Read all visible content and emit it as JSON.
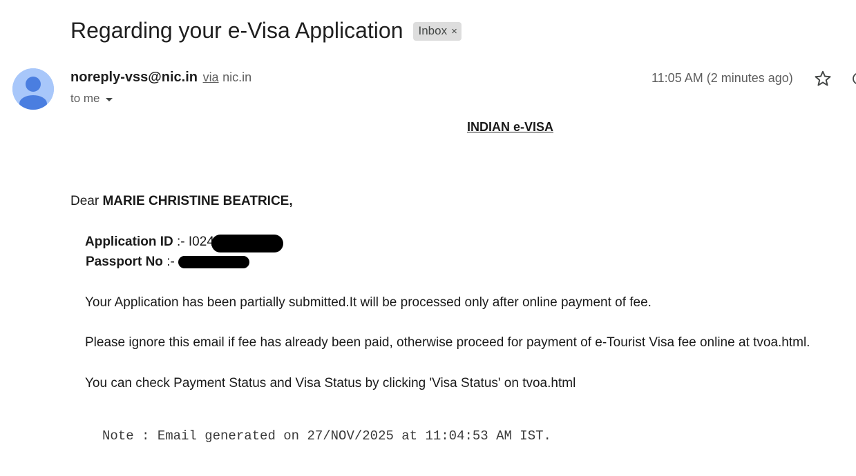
{
  "email": {
    "subject": "Regarding your e-Visa Application",
    "label_chip": "Inbox",
    "label_chip_remove": "×",
    "sender_name": "noreply-vss@nic.in",
    "via_text": "via",
    "via_domain": "nic.in",
    "recipient_text": "to me",
    "timestamp": "11:05 AM (2 minutes ago)"
  },
  "body": {
    "title": "INDIAN e-VISA",
    "greeting_prefix": "Dear ",
    "recipient_name": "MARIE CHRISTINE BEATRICE,",
    "application_id_label": "Application ID",
    "application_id_sep": " :- ",
    "application_id_visible": "I024",
    "passport_label": "Passport No",
    "passport_sep": " :- ",
    "para1": "Your Application has been partially submitted.It will be processed only after online payment of fee.",
    "para2": "Please ignore this email if fee has already been paid, otherwise proceed for payment of e-Tourist Visa fee online at tvoa.html.",
    "para3": "You can check Payment Status and Visa Status by clicking 'Visa Status' on tvoa.html",
    "note": "Note : Email generated on 27/NOV/2025 at 11:04:53 AM IST."
  },
  "icons": {
    "avatar": "person-avatar-icon",
    "star": "star-icon",
    "caret": "chevron-down-icon",
    "chip_close": "close-icon"
  },
  "colors": {
    "avatar_bg": "#a8c7fa",
    "avatar_fg": "#4a7ee0",
    "chip_bg": "#dddddd",
    "secondary_text": "#5e5e5e",
    "redaction": "#000000"
  }
}
